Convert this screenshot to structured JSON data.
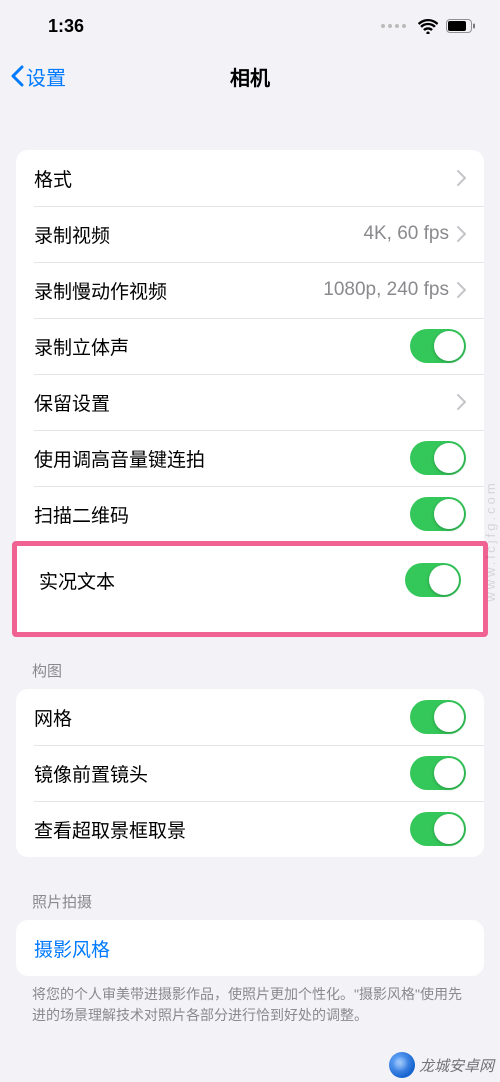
{
  "status": {
    "time": "1:36"
  },
  "nav": {
    "back": "设置",
    "title": "相机"
  },
  "group1": {
    "rows": [
      {
        "label": "格式",
        "detail": ""
      },
      {
        "label": "录制视频",
        "detail": "4K, 60 fps"
      },
      {
        "label": "录制慢动作视频",
        "detail": "1080p, 240 fps"
      },
      {
        "label": "录制立体声"
      },
      {
        "label": "保留设置"
      },
      {
        "label": "使用调高音量键连拍"
      },
      {
        "label": "扫描二维码"
      }
    ],
    "highlight": {
      "label": "实况文本"
    }
  },
  "group2": {
    "header": "构图",
    "rows": [
      {
        "label": "网格"
      },
      {
        "label": "镜像前置镜头"
      },
      {
        "label": "查看超取景框取景"
      }
    ]
  },
  "group3": {
    "header": "照片拍摄",
    "link": "摄影风格",
    "footer": "将您的个人审美带进摄影作品，使照片更加个性化。\"摄影风格\"使用先进的场景理解技术对照片各部分进行恰到好处的调整。"
  },
  "watermark": {
    "text": "龙城安卓网",
    "side": "www.lcjfg.com"
  }
}
